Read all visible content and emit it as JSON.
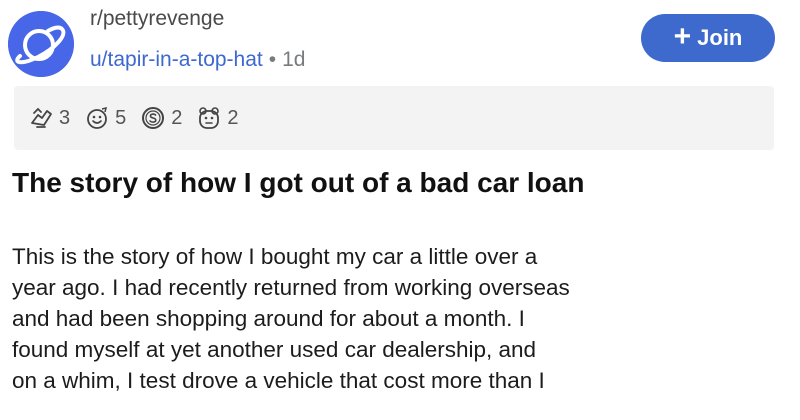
{
  "post": {
    "subreddit": "r/pettyrevenge",
    "author": "u/tapir-in-a-top-hat",
    "separator": "•",
    "age": "1d",
    "join_label": "Join",
    "join_icon": "plus-icon",
    "awards": [
      {
        "icon": "award-hands-icon",
        "count": "3"
      },
      {
        "icon": "award-smile-icon",
        "count": "5"
      },
      {
        "icon": "award-coin-icon",
        "count": "2"
      },
      {
        "icon": "award-bear-icon",
        "count": "2"
      }
    ],
    "title": "The story of how I got out of a bad car loan",
    "body_lines": [
      "This is the story of how I bought my car a little over a",
      "year ago. I had recently returned from working overseas",
      "and had been shopping around for  about a month. I",
      "found myself at yet another used car dealership, and",
      "on a whim, I test drove a vehicle that cost more than I"
    ]
  },
  "colors": {
    "accent": "#3e6acd",
    "link": "#3c68d0",
    "award_bar": "#f3f3f4"
  }
}
